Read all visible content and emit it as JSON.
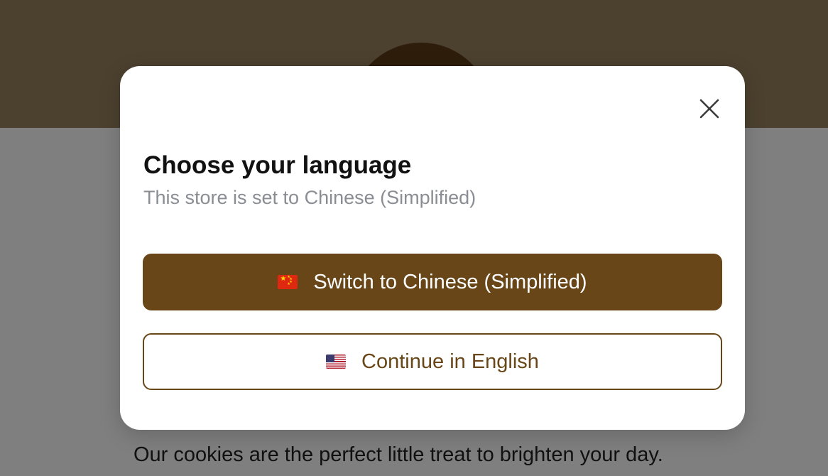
{
  "background": {
    "body_text": "Our cookies are the perfect little treat to brighten your day."
  },
  "modal": {
    "close_icon": "close-icon",
    "title": "Choose your language",
    "subtitle": "This store is set to Chinese (Simplified)",
    "primary_button": {
      "flag_icon": "china-flag-icon",
      "label": "Switch to Chinese (Simplified)"
    },
    "secondary_button": {
      "flag_icon": "us-flag-icon",
      "label": "Continue in English"
    }
  },
  "colors": {
    "accent": "#694617",
    "header_bg": "#98825f",
    "overlay": "rgba(0,0,0,0.5)",
    "subtitle_text": "#8a8d93"
  }
}
